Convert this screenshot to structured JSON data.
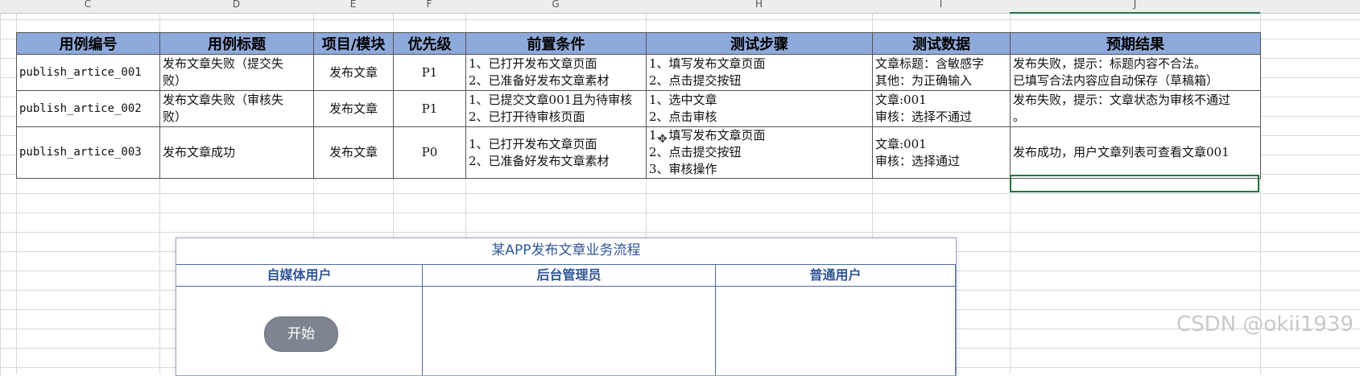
{
  "column_headers": [
    "C",
    "D",
    "E",
    "F",
    "G",
    "H",
    "I",
    "J"
  ],
  "table": {
    "headers": [
      "用例编号",
      "用例标题",
      "项目/模块",
      "优先级",
      "前置条件",
      "测试步骤",
      "测试数据",
      "预期结果"
    ],
    "rows": [
      [
        "publish_artice_001",
        "发布文章失败（提交失\n败）",
        "发布文章",
        "P1",
        "1、已打开发布文章页面\n2、已准备好发布文章素材",
        "1、填写发布文章页面\n2、点击提交按钮",
        "文章标题：含敏感字\n其他：为正确输入",
        "发布失败，提示：标题内容不合法。\n已填写合法内容应自动保存（草稿箱）"
      ],
      [
        "publish_artice_002",
        "发布文章失败（审核失\n败）",
        "发布文章",
        "P1",
        "1、已提交文章001且为待审核\n2、已打开待审核页面",
        "1、选中文章\n2、点击审核",
        "文章:001\n审核：选择不通过",
        "发布失败，提示：文章状态为审核不通过\n。"
      ],
      [
        "publish_artice_003",
        "发布文章成功",
        "发布文章",
        "P0",
        "1、已打开发布文章页面\n2、已准备好发布文章素材",
        "1、填写发布文章页面\n2、点击提交按钮\n3、审核操作",
        "文章:001\n审核：选择通过",
        "发布成功，用户文章列表可查看文章001"
      ]
    ]
  },
  "flowchart": {
    "title": "某APP发布文章业务流程",
    "lanes": [
      "自媒体用户",
      "后台管理员",
      "普通用户"
    ],
    "start_node": "开始"
  },
  "watermark": "CSDN @okii1939"
}
